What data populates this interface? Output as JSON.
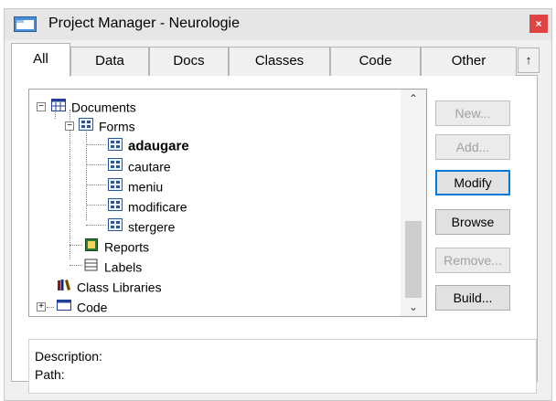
{
  "window": {
    "title": "Project Manager - Neurologie",
    "close_glyph": "×",
    "accent": "#e04343"
  },
  "tabs": [
    {
      "label": "All",
      "active": true
    },
    {
      "label": "Data",
      "active": false
    },
    {
      "label": "Docs",
      "active": false
    },
    {
      "label": "Classes",
      "active": false
    },
    {
      "label": "Code",
      "active": false
    },
    {
      "label": "Other",
      "active": false
    }
  ],
  "tab_scroll_glyph": "↑",
  "tree": {
    "documents": {
      "label": "Documents",
      "expander": "−",
      "icon": "documents-icon"
    },
    "forms": {
      "label": "Forms",
      "expander": "−",
      "icon": "form-group-icon"
    },
    "form_items": [
      "adaugare",
      "cautare",
      "meniu",
      "modificare",
      "stergere"
    ],
    "reports": {
      "label": "Reports",
      "icon": "report-icon"
    },
    "labels": {
      "label": "Labels",
      "icon": "label-icon"
    },
    "class_libraries": {
      "label": "Class Libraries",
      "icon": "class-library-icon"
    },
    "code": {
      "label": "Code",
      "expander": "+",
      "icon": "code-icon"
    }
  },
  "scrollbar": {
    "up_glyph": "⌃",
    "down_glyph": "⌄"
  },
  "buttons": {
    "new": {
      "label": "New...",
      "disabled": true
    },
    "add": {
      "label": "Add...",
      "disabled": true
    },
    "modify": {
      "label": "Modify",
      "disabled": false
    },
    "browse": {
      "label": "Browse",
      "disabled": false
    },
    "remove": {
      "label": "Remove...",
      "disabled": true
    },
    "build": {
      "label": "Build...",
      "disabled": false
    }
  },
  "details": {
    "description_label": "Description:",
    "path_label": "Path:"
  }
}
